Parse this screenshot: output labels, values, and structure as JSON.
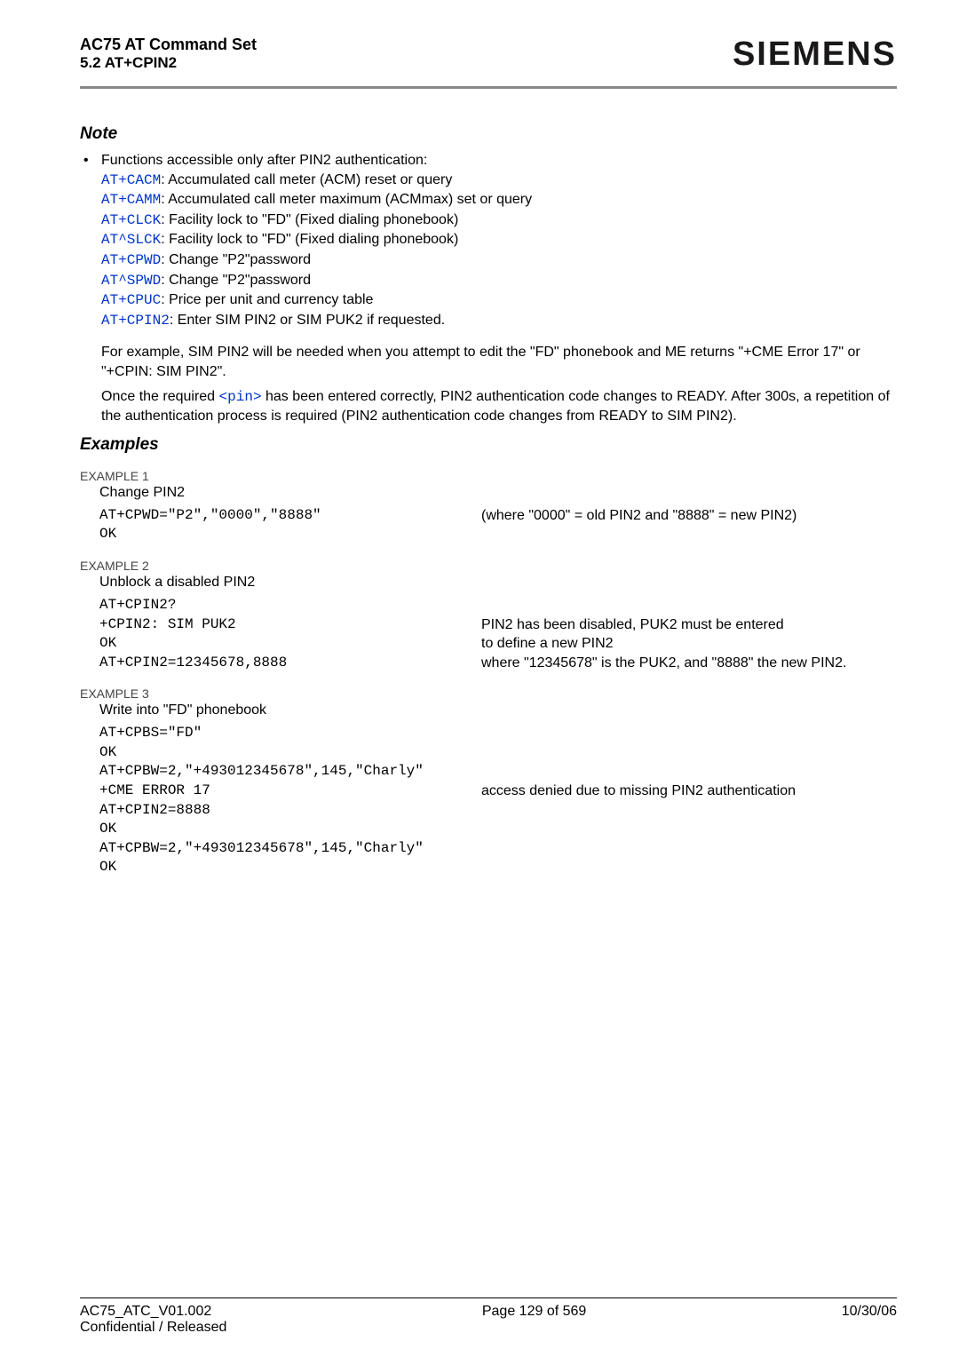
{
  "header": {
    "title": "AC75 AT Command Set",
    "subtitle": "5.2 AT+CPIN2",
    "brand": "SIEMENS"
  },
  "note": {
    "heading": "Note",
    "bullet_intro": "Functions accessible only after PIN2 authentication:",
    "cmds": [
      {
        "cmd": "AT+CACM",
        "desc": ": Accumulated call meter (ACM) reset or query"
      },
      {
        "cmd": "AT+CAMM",
        "desc": ": Accumulated call meter maximum (ACMmax) set or query"
      },
      {
        "cmd": "AT+CLCK",
        "desc": ": Facility lock to \"FD\" (Fixed dialing phonebook)"
      },
      {
        "cmd": "AT^SLCK",
        "desc": ": Facility lock to \"FD\" (Fixed dialing phonebook)"
      },
      {
        "cmd": "AT+CPWD",
        "desc": ": Change \"P2\"password"
      },
      {
        "cmd": "AT^SPWD",
        "desc": ": Change \"P2\"password"
      },
      {
        "cmd": "AT+CPUC",
        "desc": ": Price per unit and currency table"
      },
      {
        "cmd": "AT+CPIN2",
        "desc": ": Enter SIM PIN2 or SIM PUK2 if requested."
      }
    ],
    "para1": "For example, SIM PIN2 will be needed when you attempt to edit the \"FD\" phonebook and ME returns \"+CME Error 17\" or \"+CPIN: SIM PIN2\".",
    "para2_a": "Once the required ",
    "para2_pin": "<pin>",
    "para2_b": " has been entered correctly, PIN2 authentication code changes to READY. After 300s, a repetition of the authentication process is required (PIN2 authentication code changes from READY to SIM PIN2)."
  },
  "examples": {
    "heading": "Examples",
    "ex1": {
      "label": "EXAMPLE 1",
      "desc": "Change PIN2",
      "rows": [
        {
          "code": "AT+CPWD=\"P2\",\"0000\",\"8888\"",
          "expl": "(where \"0000\" = old PIN2 and \"8888\" = new PIN2)"
        },
        {
          "code": "OK",
          "expl": ""
        }
      ]
    },
    "ex2": {
      "label": "EXAMPLE 2",
      "desc": "Unblock a disabled PIN2",
      "rows": [
        {
          "code": "AT+CPIN2?",
          "expl": ""
        },
        {
          "code": "+CPIN2: SIM PUK2",
          "expl": "PIN2 has been disabled, PUK2 must be entered"
        },
        {
          "code": "OK",
          "expl": "to define a new PIN2"
        },
        {
          "code": "AT+CPIN2=12345678,8888",
          "expl": "where \"12345678\" is the PUK2, and \"8888\" the new PIN2."
        }
      ]
    },
    "ex3": {
      "label": "EXAMPLE 3",
      "desc": "Write into \"FD\" phonebook",
      "rows": [
        {
          "code": "AT+CPBS=\"FD\"",
          "expl": ""
        },
        {
          "code": "OK",
          "expl": ""
        },
        {
          "code": "AT+CPBW=2,\"+493012345678\",145,\"Charly\"",
          "expl": ""
        },
        {
          "code": "+CME ERROR 17",
          "expl": "access denied due to missing PIN2 authentication"
        },
        {
          "code": "AT+CPIN2=8888",
          "expl": ""
        },
        {
          "code": "OK",
          "expl": ""
        },
        {
          "code": "AT+CPBW=2,\"+493012345678\",145,\"Charly\"",
          "expl": ""
        },
        {
          "code": "OK",
          "expl": ""
        }
      ]
    }
  },
  "footer": {
    "left1": "AC75_ATC_V01.002",
    "left2": "Confidential / Released",
    "center": "Page 129 of 569",
    "right": "10/30/06"
  }
}
